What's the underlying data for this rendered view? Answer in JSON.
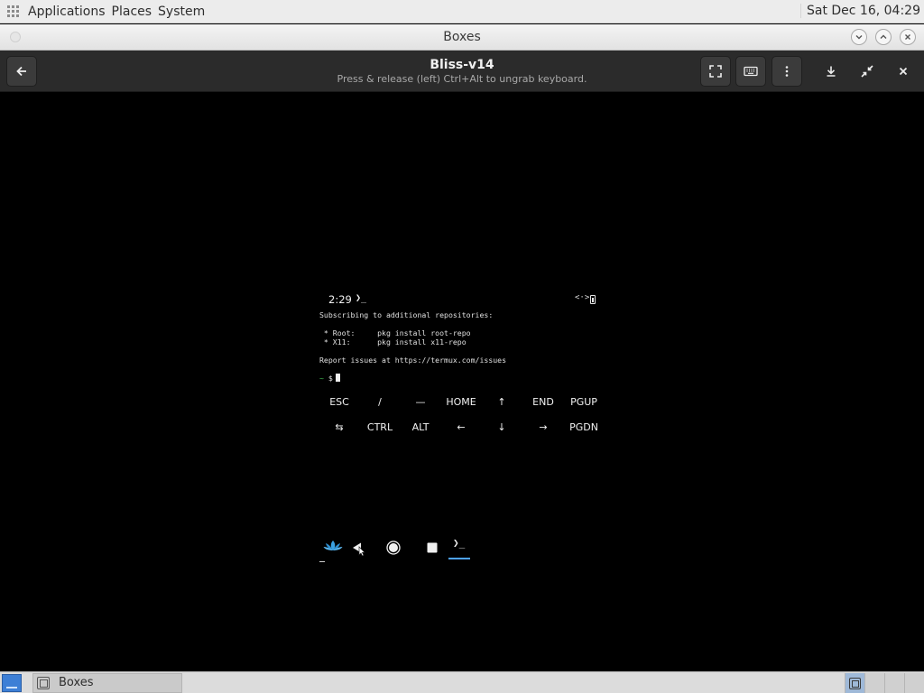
{
  "top_panel": {
    "menus": [
      "Applications",
      "Places",
      "System"
    ],
    "clock": "Sat Dec 16, 04:29"
  },
  "window": {
    "title": "Boxes"
  },
  "header": {
    "title": "Bliss-v14",
    "subtitle": "Press & release (left) Ctrl+Alt to ungrab keyboard."
  },
  "vm": {
    "status_time": "2:29",
    "status_prompt_icon": "❯_",
    "status_right_icon": "<·>",
    "terminal_lines": [
      "Subscribing to additional repositories:",
      "",
      " * Root:     pkg install root-repo",
      " * X11:      pkg install x11-repo",
      "",
      "Report issues at https://termux.com/issues"
    ],
    "prompt_tilde": "~",
    "prompt_symbol": "$",
    "extra_keys_row1": [
      "ESC",
      "/",
      "—",
      "HOME",
      "↑",
      "END",
      "PGUP"
    ],
    "extra_keys_row2": [
      "⇆",
      "CTRL",
      "ALT",
      "←",
      "↓",
      "→",
      "PGDN"
    ],
    "nav_terminal_label": "❯_"
  },
  "taskbar": {
    "task_label": "Boxes"
  }
}
